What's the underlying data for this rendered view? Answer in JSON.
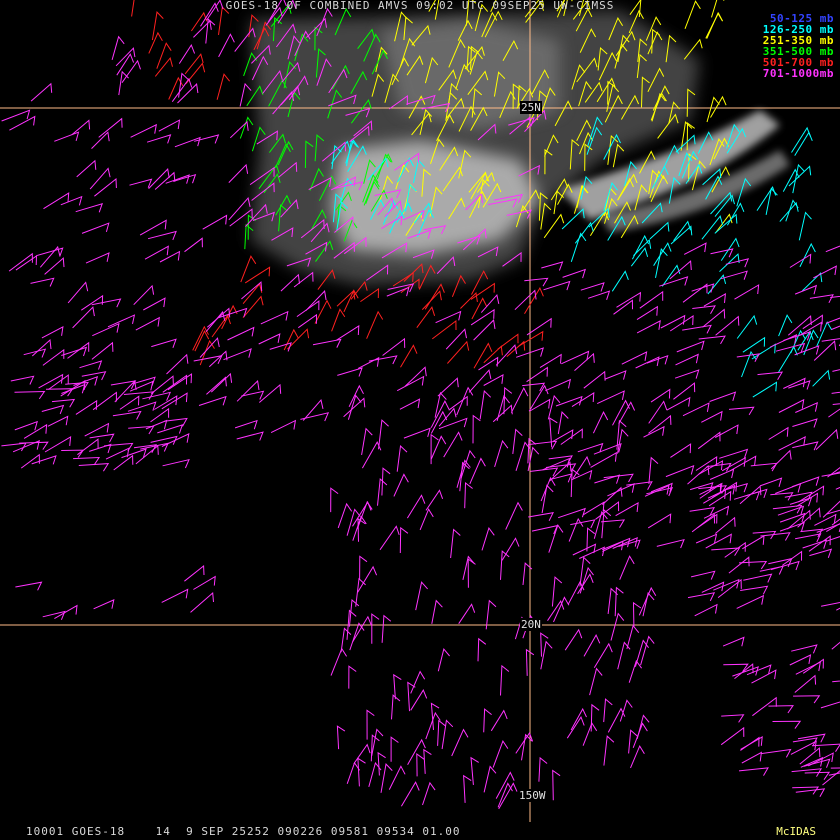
{
  "header": {
    "title": "GOES-18 OF COMBINED AMVS 09:02 UTC 09SEP25 UW-CIMSS"
  },
  "legend": [
    {
      "label": "50-125 mb",
      "color": "#3344ff"
    },
    {
      "label": "126-250 mb",
      "color": "#00ffff"
    },
    {
      "label": "251-350 mb",
      "color": "#ffff00"
    },
    {
      "label": "351-500 mb",
      "color": "#00ff00"
    },
    {
      "label": "501-700 mb",
      "color": "#ff2020"
    },
    {
      "label": "701-1000mb",
      "color": "#ff33ff"
    }
  ],
  "grid": {
    "line_color": "#ffbb88",
    "labels": {
      "lat_25": "25N",
      "lat_20": "20N",
      "lon_150": "150W"
    }
  },
  "footer": {
    "info": "10001 GOES-18    14  9 SEP 25252 090226 09581 09534 01.00",
    "brand": "McIDAS"
  }
}
